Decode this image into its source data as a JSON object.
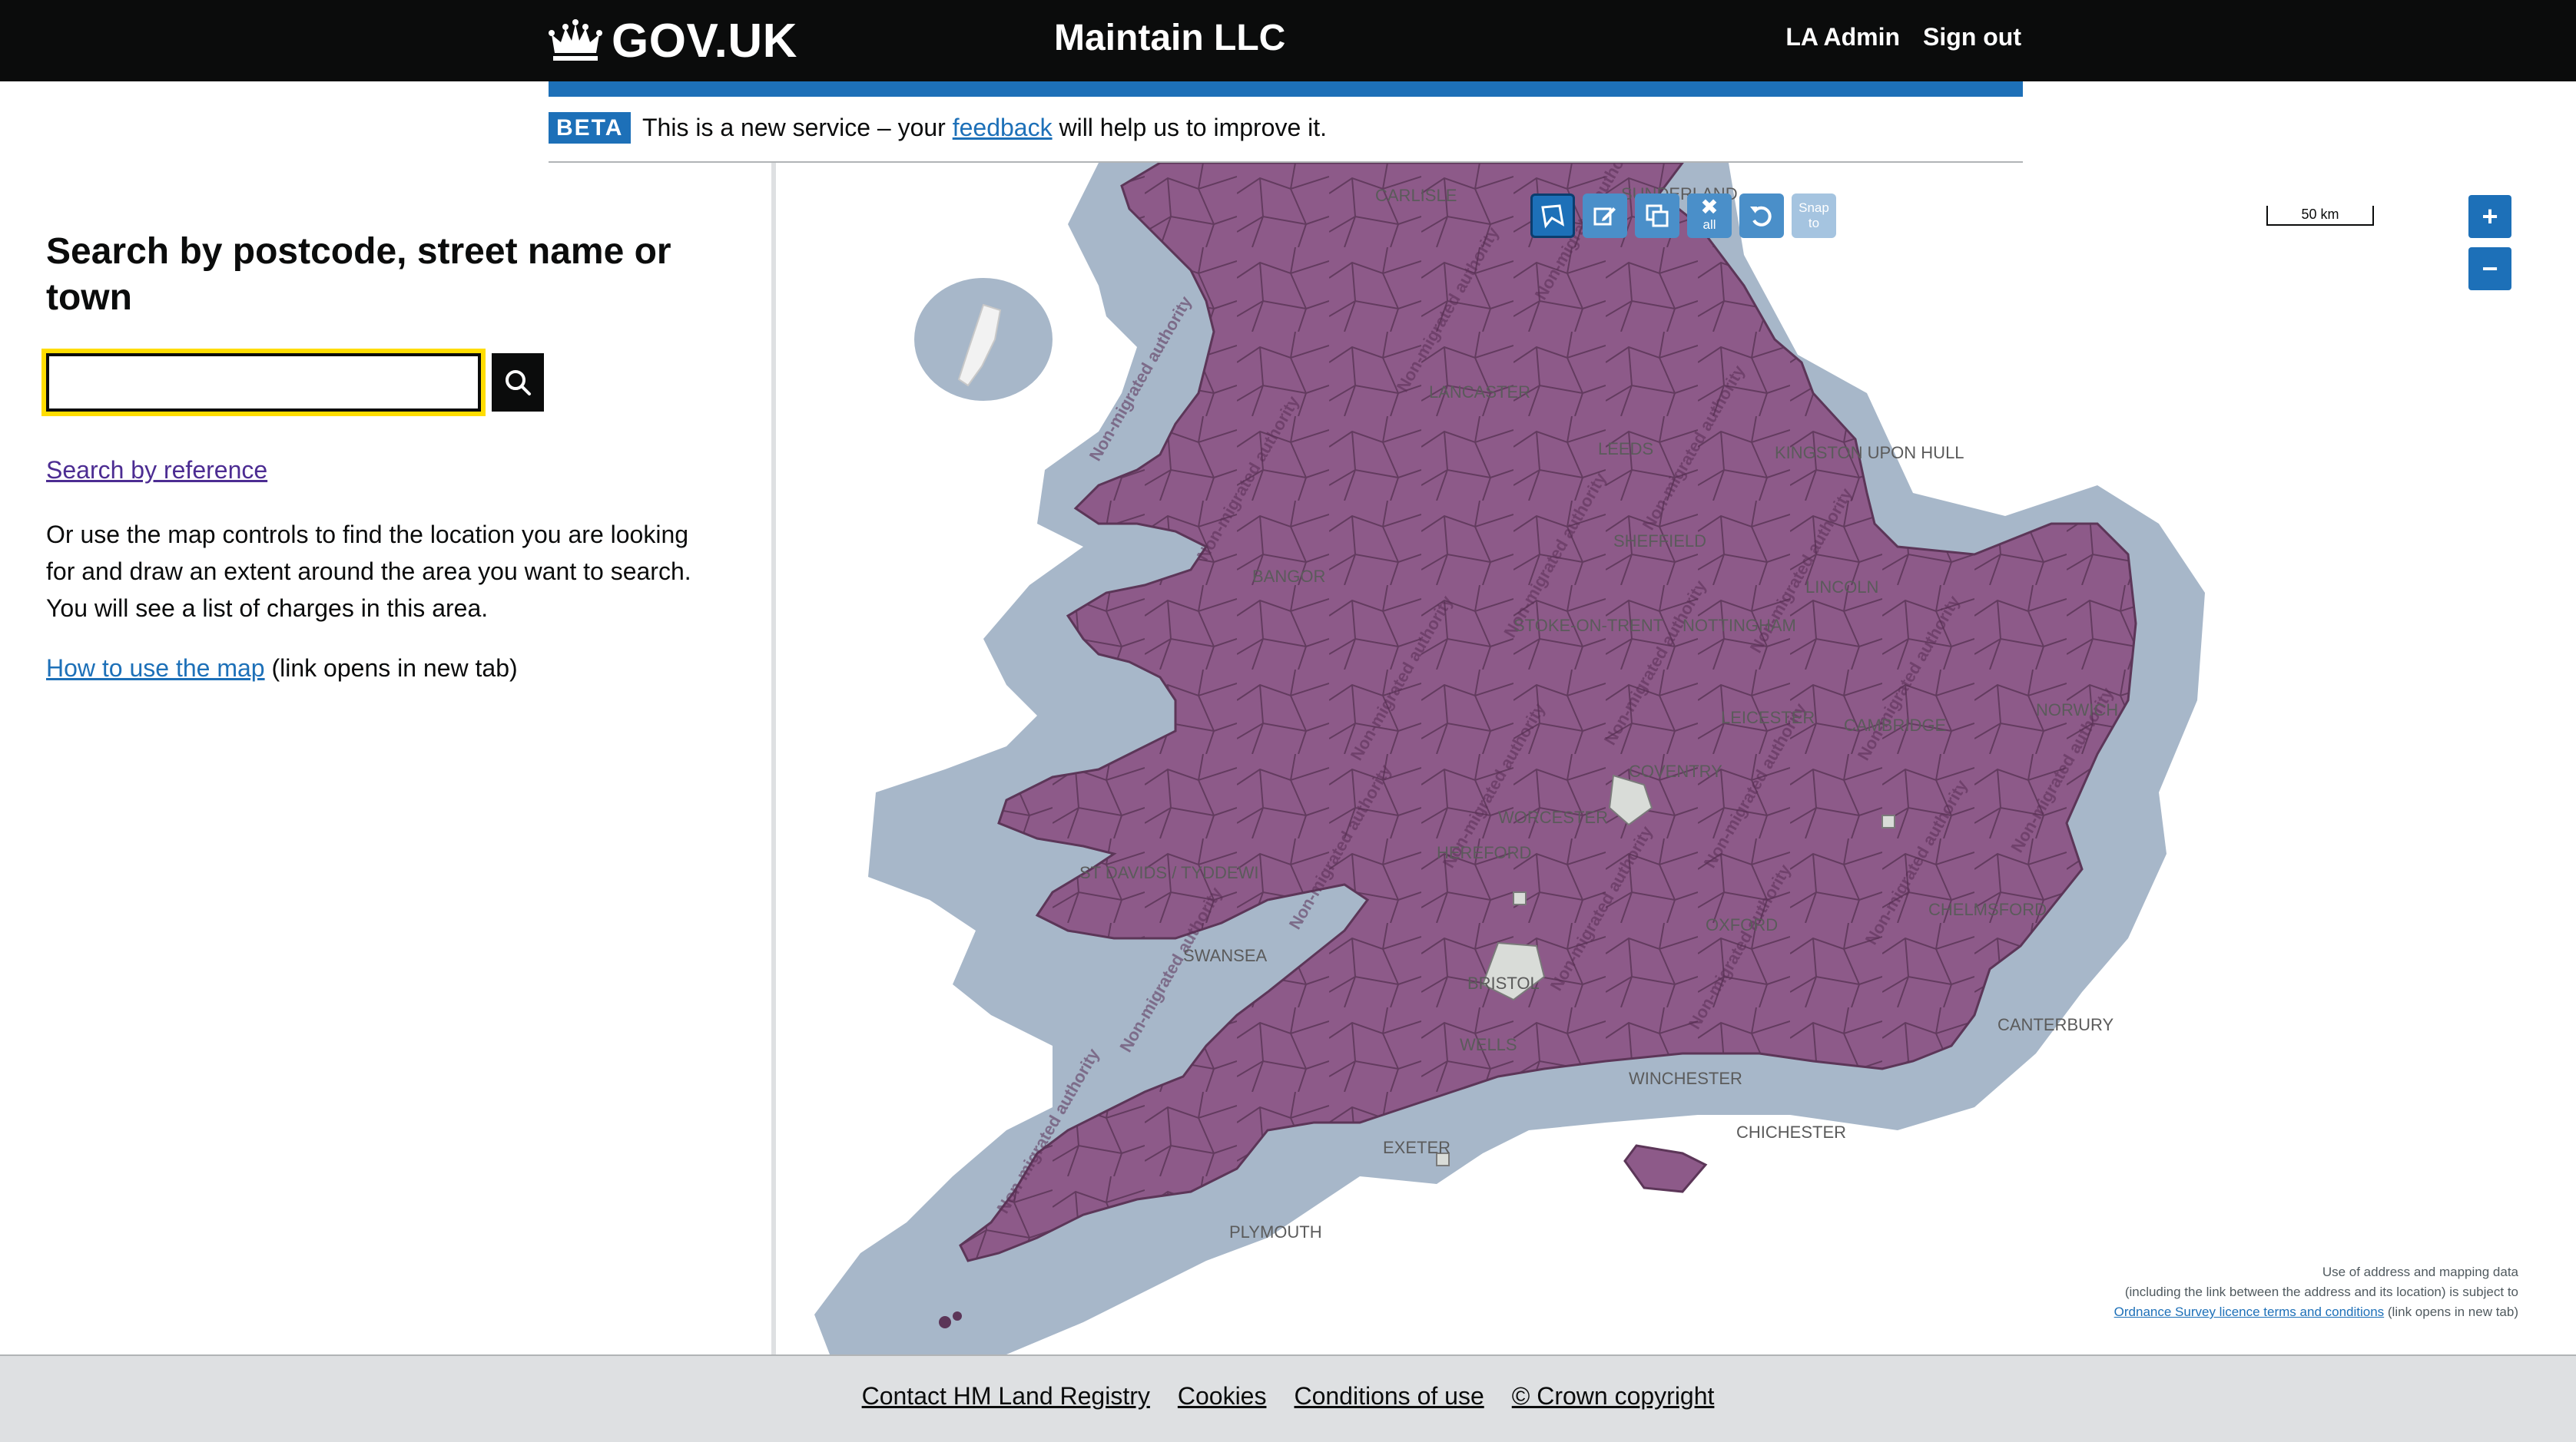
{
  "header": {
    "logo_text": "GOV.UK",
    "service_name": "Maintain LLC",
    "nav": [
      {
        "label": "LA Admin"
      },
      {
        "label": "Sign out"
      }
    ]
  },
  "phase_banner": {
    "tag": "BETA",
    "text_before": "This is a new service – your ",
    "link": "feedback",
    "text_after": " will help us to improve it."
  },
  "search": {
    "heading": "Search by postcode, street name or town",
    "input_value": "",
    "button_icon": "search-icon",
    "reference_link": "Search by reference",
    "intro": "Or use the map controls to find the location you are looking for and draw an extent around the area you want to search. You will see a list of charges in this area.",
    "how_to_link": "How to use the map",
    "how_to_suffix": " (link opens in new tab)"
  },
  "map": {
    "tools": [
      {
        "name": "draw-polygon-icon"
      },
      {
        "name": "edit-icon"
      },
      {
        "name": "copy-icon"
      },
      {
        "name": "clear-all-icon",
        "label": "all"
      },
      {
        "name": "undo-icon"
      },
      {
        "name": "snap-to-icon",
        "label": "Snap to"
      }
    ],
    "scale_label": "50 km",
    "zoom_in": "+",
    "zoom_out": "−",
    "watermark_text": "Non-migrated authority",
    "place_labels": [
      "CARLISLE",
      "SUNDERLAND",
      "LANCASTER",
      "LEEDS",
      "KINGSTON UPON HULL",
      "SHEFFIELD",
      "LINCOLN",
      "BANGOR",
      "STOKE-ON-TRENT",
      "NOTTINGHAM",
      "NORWICH",
      "LEICESTER",
      "CAMBRIDGE",
      "COVENTRY",
      "WORCESTER",
      "HEREFORD",
      "ST DAVIDS / TYDDEWI",
      "SWANSEA",
      "OXFORD",
      "CHELMSFORD",
      "BRISTOL",
      "WELLS",
      "WINCHESTER",
      "CANTERBURY",
      "CHICHESTER",
      "EXETER",
      "PLYMOUTH"
    ],
    "attribution": {
      "line1": "Use of address and mapping data",
      "line2": "(including the link between the address and its location) is subject to",
      "link": "Ordnance Survey licence terms and conditions",
      "suffix": " (link opens in new tab)"
    },
    "colors": {
      "sea_buffer": "#a7b7c9",
      "land_migrated": "#8d5a89",
      "boundary": "#5c3658",
      "unmigrated_pocket": "#d9dcd8"
    }
  },
  "footer": {
    "links": [
      {
        "label": "Contact HM Land Registry"
      },
      {
        "label": "Cookies"
      },
      {
        "label": "Conditions of use"
      },
      {
        "label": "© Crown copyright"
      }
    ]
  }
}
